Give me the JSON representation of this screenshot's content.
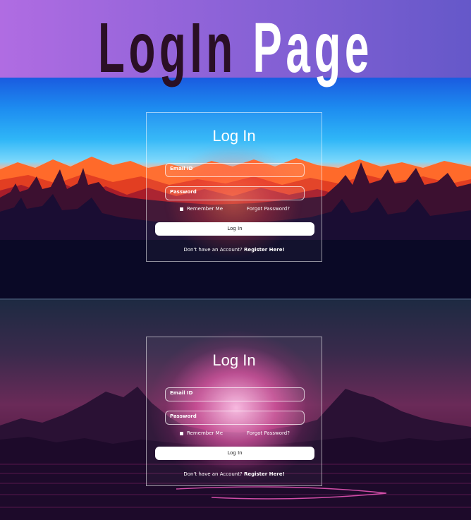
{
  "header": {
    "title_part1": "LogIn",
    "title_part2": "Page"
  },
  "login": {
    "heading": "Log In",
    "email_placeholder": "Email ID",
    "password_placeholder": "Password",
    "remember_label": "Remember Me",
    "forgot_label": "Forgot Password?",
    "login_button": "Log In",
    "register_prompt": "Don't have an Account?",
    "register_link": "Register Here!"
  },
  "colors": {
    "header_gradient": [
      "#b06ce2",
      "#6558c9"
    ],
    "title_dark": "#2a0f25",
    "title_light": "#ffffff"
  }
}
